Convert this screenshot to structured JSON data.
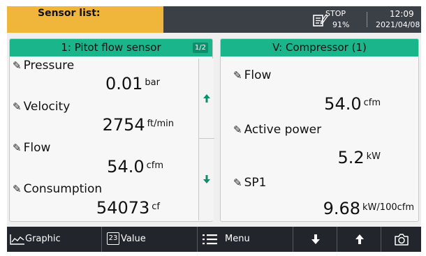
{
  "header": {
    "title": "Sensor list:",
    "status_state": "STOP",
    "status_percent": "91%",
    "time": "12:09",
    "date": "2021/04/08",
    "colors": {
      "title_bg": "#f0b63c",
      "bar_bg": "#3b3f46"
    }
  },
  "left_panel": {
    "title": "1: Pitot flow sensor",
    "page": "1/2",
    "items": [
      {
        "label": "Pressure",
        "value": "0.01",
        "unit": "bar"
      },
      {
        "label": "Velocity",
        "value": "2754",
        "unit": "ft/min"
      },
      {
        "label": "Flow",
        "value": "54.0",
        "unit": "cfm"
      },
      {
        "label": "Consumption",
        "value": "54073",
        "unit": "cf"
      }
    ],
    "scroll_up_icon": "arrow-up-icon",
    "scroll_down_icon": "arrow-down-icon"
  },
  "right_panel": {
    "title": "V: Compressor (1)",
    "items": [
      {
        "label": "Flow",
        "value": "54.0",
        "unit": "cfm"
      },
      {
        "label": "Active power",
        "value": "5.2",
        "unit": "kW"
      },
      {
        "label": "SP1",
        "value": "9.68",
        "unit": "kW/100cfm"
      }
    ]
  },
  "toolbar": {
    "graphic_label": "Graphic",
    "value_label": "Value",
    "value_icon_text": "23",
    "menu_label": "Menu",
    "icons": [
      "graph-icon",
      "value-icon",
      "menu-icon",
      "arrow-down-icon",
      "arrow-up-icon",
      "camera-icon"
    ]
  },
  "colors": {
    "accent": "#1bb58c",
    "toolbar_bg": "#22262c"
  }
}
